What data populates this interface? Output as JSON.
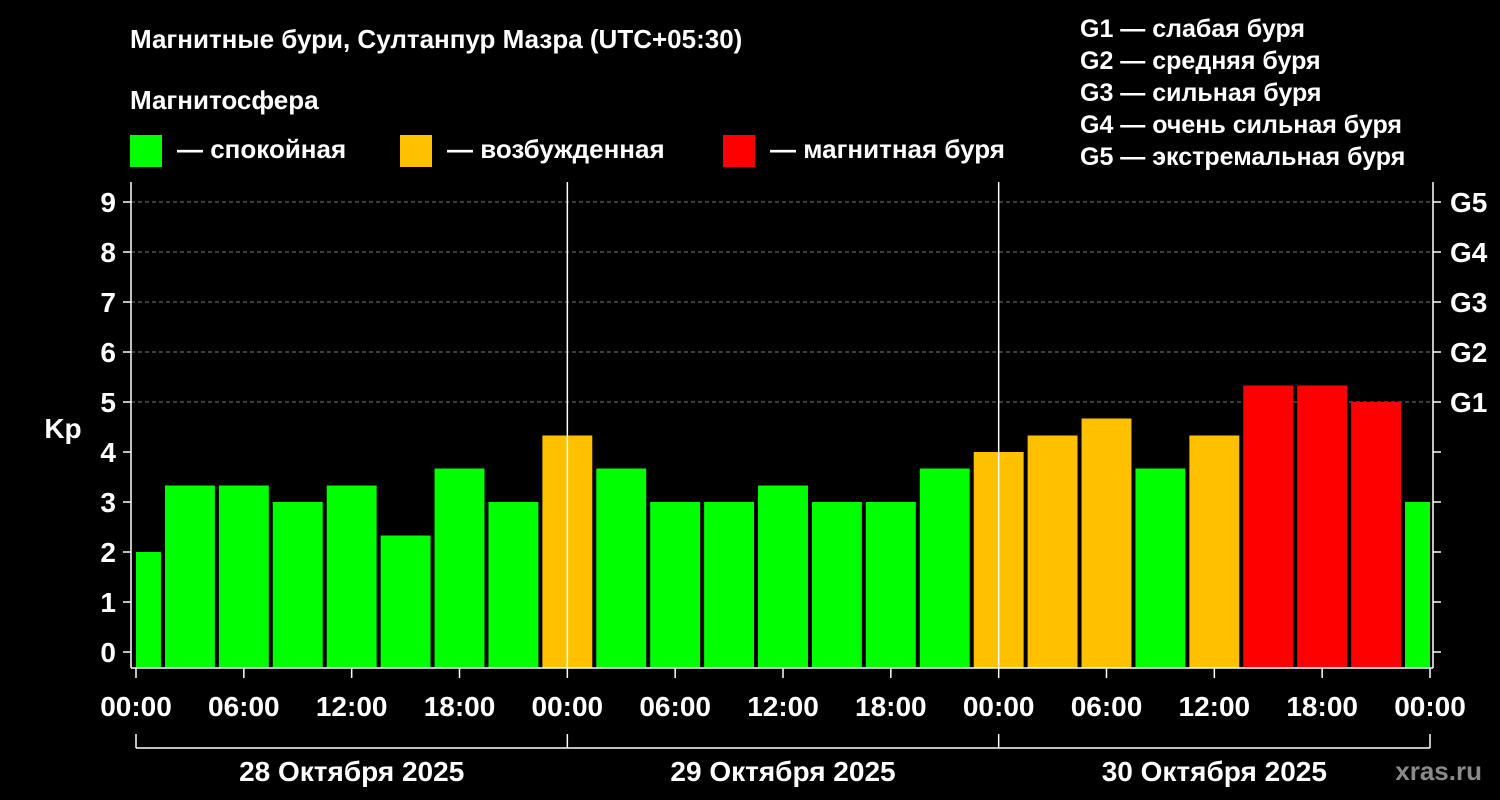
{
  "chart_data": {
    "type": "bar",
    "title": "Магнитные бури, Султанпур Мазра (UTC+05:30)",
    "ylabel": "Kp",
    "ylim": [
      0,
      9
    ],
    "yticks": [
      "0",
      "1",
      "2",
      "3",
      "4",
      "5",
      "6",
      "7",
      "8",
      "9"
    ],
    "right_axis": [
      {
        "level": 5,
        "label": "G1"
      },
      {
        "level": 6,
        "label": "G2"
      },
      {
        "level": 7,
        "label": "G3"
      },
      {
        "level": 8,
        "label": "G4"
      },
      {
        "level": 9,
        "label": "G5"
      }
    ],
    "storm_legend": [
      "G1 — слабая буря",
      "G2 — средняя буря",
      "G3 — сильная буря",
      "G4 — очень сильная буря",
      "G5 — экстремальная буря"
    ],
    "magnetosphere": {
      "title": "Магнитосфера",
      "states": [
        {
          "key": "calm",
          "label": "— спокойная",
          "color": "#00ff00"
        },
        {
          "key": "excited",
          "label": "— возбужденная",
          "color": "#ffc000"
        },
        {
          "key": "storm",
          "label": "— магнитная буря",
          "color": "#ff0000"
        }
      ]
    },
    "x_start_hours": -4.5,
    "x_end_hours": 67.5,
    "x_ticks": [
      {
        "hour": 0,
        "label": "00:00"
      },
      {
        "hour": 6,
        "label": "06:00"
      },
      {
        "hour": 12,
        "label": "12:00"
      },
      {
        "hour": 18,
        "label": "18:00"
      },
      {
        "hour": 24,
        "label": "00:00"
      },
      {
        "hour": 30,
        "label": "06:00"
      },
      {
        "hour": 36,
        "label": "12:00"
      },
      {
        "hour": 42,
        "label": "18:00"
      },
      {
        "hour": 48,
        "label": "00:00"
      },
      {
        "hour": 54,
        "label": "06:00"
      },
      {
        "hour": 60,
        "label": "12:00"
      },
      {
        "hour": 66,
        "label": "18:00"
      },
      {
        "hour": 72,
        "label": "00:00"
      }
    ],
    "day_dividers_hours": [
      24,
      48
    ],
    "days": [
      {
        "label": "28 Октября 2025",
        "start_hour": 0,
        "end_hour": 24
      },
      {
        "label": "29 Октября 2025",
        "start_hour": 24,
        "end_hour": 48
      },
      {
        "label": "30 Октября 2025",
        "start_hour": 48,
        "end_hour": 72
      }
    ],
    "bars": [
      {
        "start_hour": 0,
        "end_hour": 1.5,
        "value": 2.0,
        "state": "calm"
      },
      {
        "start_hour": 1.5,
        "end_hour": 4.5,
        "value": 3.33,
        "state": "calm"
      },
      {
        "start_hour": 4.5,
        "end_hour": 7.5,
        "value": 3.33,
        "state": "calm"
      },
      {
        "start_hour": 7.5,
        "end_hour": 10.5,
        "value": 3.0,
        "state": "calm"
      },
      {
        "start_hour": 10.5,
        "end_hour": 13.5,
        "value": 3.33,
        "state": "calm"
      },
      {
        "start_hour": 13.5,
        "end_hour": 16.5,
        "value": 2.33,
        "state": "calm"
      },
      {
        "start_hour": 16.5,
        "end_hour": 19.5,
        "value": 3.67,
        "state": "calm"
      },
      {
        "start_hour": 19.5,
        "end_hour": 22.5,
        "value": 3.0,
        "state": "calm"
      },
      {
        "start_hour": 22.5,
        "end_hour": 25.5,
        "value": 4.33,
        "state": "excited"
      },
      {
        "start_hour": 25.5,
        "end_hour": 28.5,
        "value": 3.67,
        "state": "calm"
      },
      {
        "start_hour": 28.5,
        "end_hour": 31.5,
        "value": 3.0,
        "state": "calm"
      },
      {
        "start_hour": 31.5,
        "end_hour": 34.5,
        "value": 3.0,
        "state": "calm"
      },
      {
        "start_hour": 34.5,
        "end_hour": 37.5,
        "value": 3.33,
        "state": "calm"
      },
      {
        "start_hour": 37.5,
        "end_hour": 40.5,
        "value": 3.0,
        "state": "calm"
      },
      {
        "start_hour": 40.5,
        "end_hour": 43.5,
        "value": 3.0,
        "state": "calm"
      },
      {
        "start_hour": 43.5,
        "end_hour": 46.5,
        "value": 3.67,
        "state": "calm"
      },
      {
        "start_hour": 46.5,
        "end_hour": 49.5,
        "value": 4.0,
        "state": "excited"
      },
      {
        "start_hour": 49.5,
        "end_hour": 52.5,
        "value": 4.33,
        "state": "excited"
      },
      {
        "start_hour": 52.5,
        "end_hour": 55.5,
        "value": 4.67,
        "state": "excited"
      },
      {
        "start_hour": 55.5,
        "end_hour": 58.5,
        "value": 3.67,
        "state": "calm"
      },
      {
        "start_hour": 58.5,
        "end_hour": 61.5,
        "value": 4.33,
        "state": "excited"
      },
      {
        "start_hour": 61.5,
        "end_hour": 64.5,
        "value": 5.33,
        "state": "storm"
      },
      {
        "start_hour": 64.5,
        "end_hour": 67.5,
        "value": 5.33,
        "state": "storm"
      },
      {
        "start_hour": 67.5,
        "end_hour": 70.5,
        "value": 5.0,
        "state": "storm"
      },
      {
        "start_hour": 70.5,
        "end_hour": 72,
        "value": 3.0,
        "state": "calm"
      }
    ],
    "grid": true,
    "watermark": "xras.ru"
  }
}
